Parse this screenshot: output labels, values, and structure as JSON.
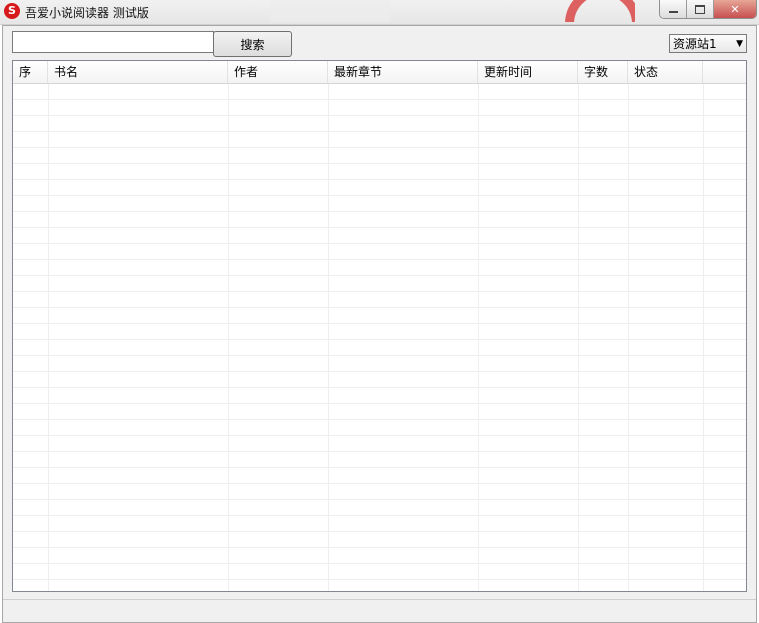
{
  "window": {
    "title": "吾爱小说阅读器 测试版",
    "app_icon_glyph": "S",
    "controls": {
      "minimize": "minimize-icon",
      "maximize": "maximize-icon",
      "close_glyph": "✕"
    }
  },
  "toolbar": {
    "search": {
      "value": "",
      "placeholder": ""
    },
    "search_button_label": "搜索",
    "site_select": {
      "selected": "资源站1",
      "caret": "▼"
    }
  },
  "list": {
    "columns": [
      "序",
      "书名",
      "作者",
      "最新章节",
      "更新时间",
      "字数",
      "状态",
      ""
    ],
    "row_count": 31,
    "rows": []
  },
  "colors": {
    "close_button": "#c75050",
    "app_icon": "#d7191c"
  }
}
